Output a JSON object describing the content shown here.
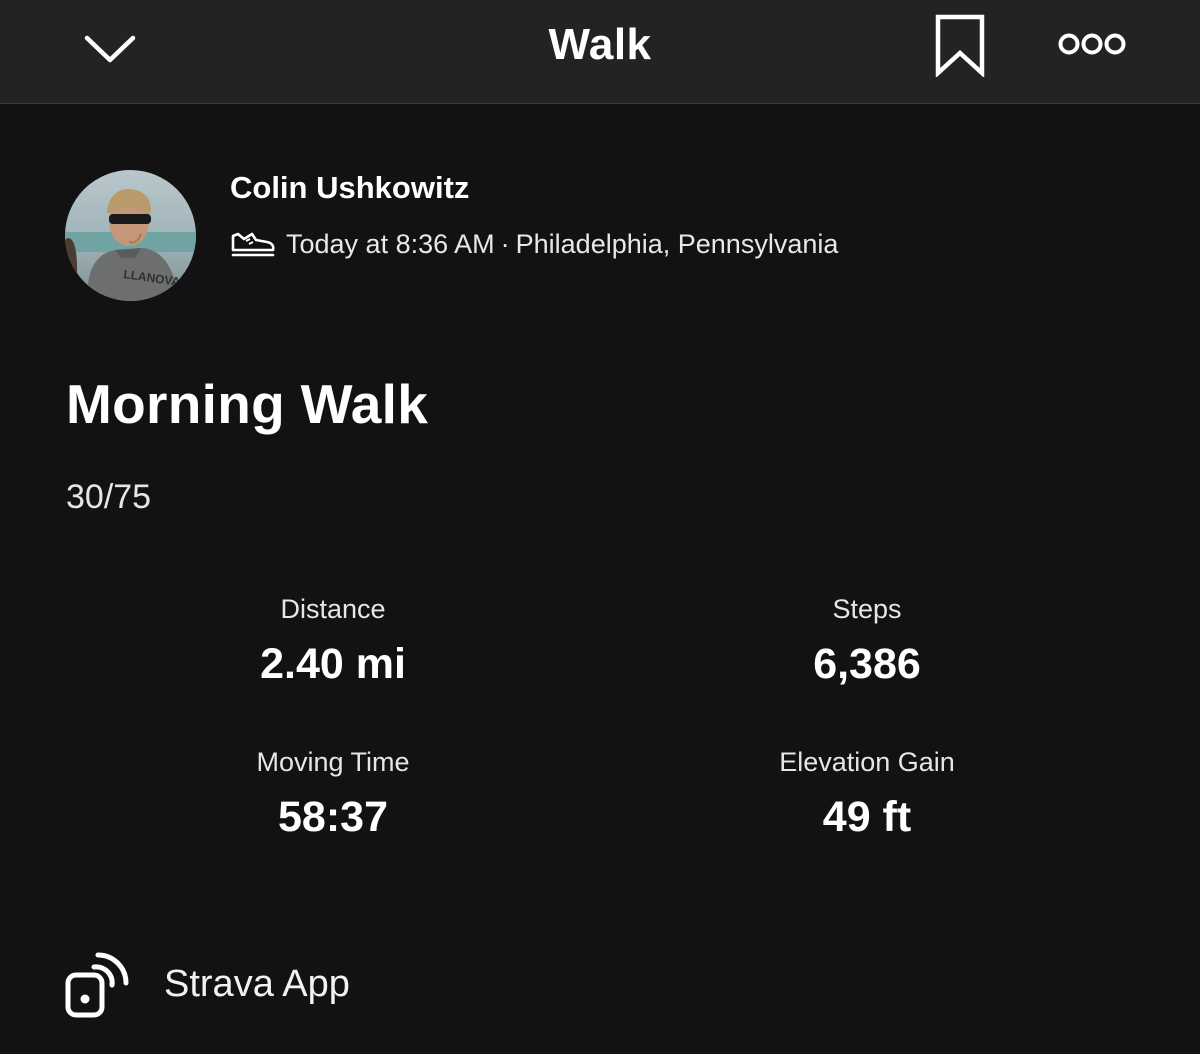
{
  "header": {
    "title": "Walk",
    "back_icon": "chevron-down-icon",
    "bookmark_icon": "bookmark-icon",
    "more_icon": "more-dots-icon"
  },
  "athlete": {
    "name": "Colin Ushkowitz",
    "activity_icon": "walk-shoe-icon",
    "time": "Today at 8:36 AM",
    "separator": "·",
    "location": "Philadelphia, Pennsylvania"
  },
  "activity": {
    "title": "Morning Walk",
    "description": "30/75"
  },
  "stats": [
    {
      "label": "Distance",
      "value": "2.40 mi"
    },
    {
      "label": "Steps",
      "value": "6,386"
    },
    {
      "label": "Moving Time",
      "value": "58:37"
    },
    {
      "label": "Elevation Gain",
      "value": "49 ft"
    }
  ],
  "device": {
    "icon": "device-sync-icon",
    "label": "Strava App"
  },
  "colors": {
    "background": "#121212",
    "topbar": "#232323",
    "text": "#ffffff"
  }
}
